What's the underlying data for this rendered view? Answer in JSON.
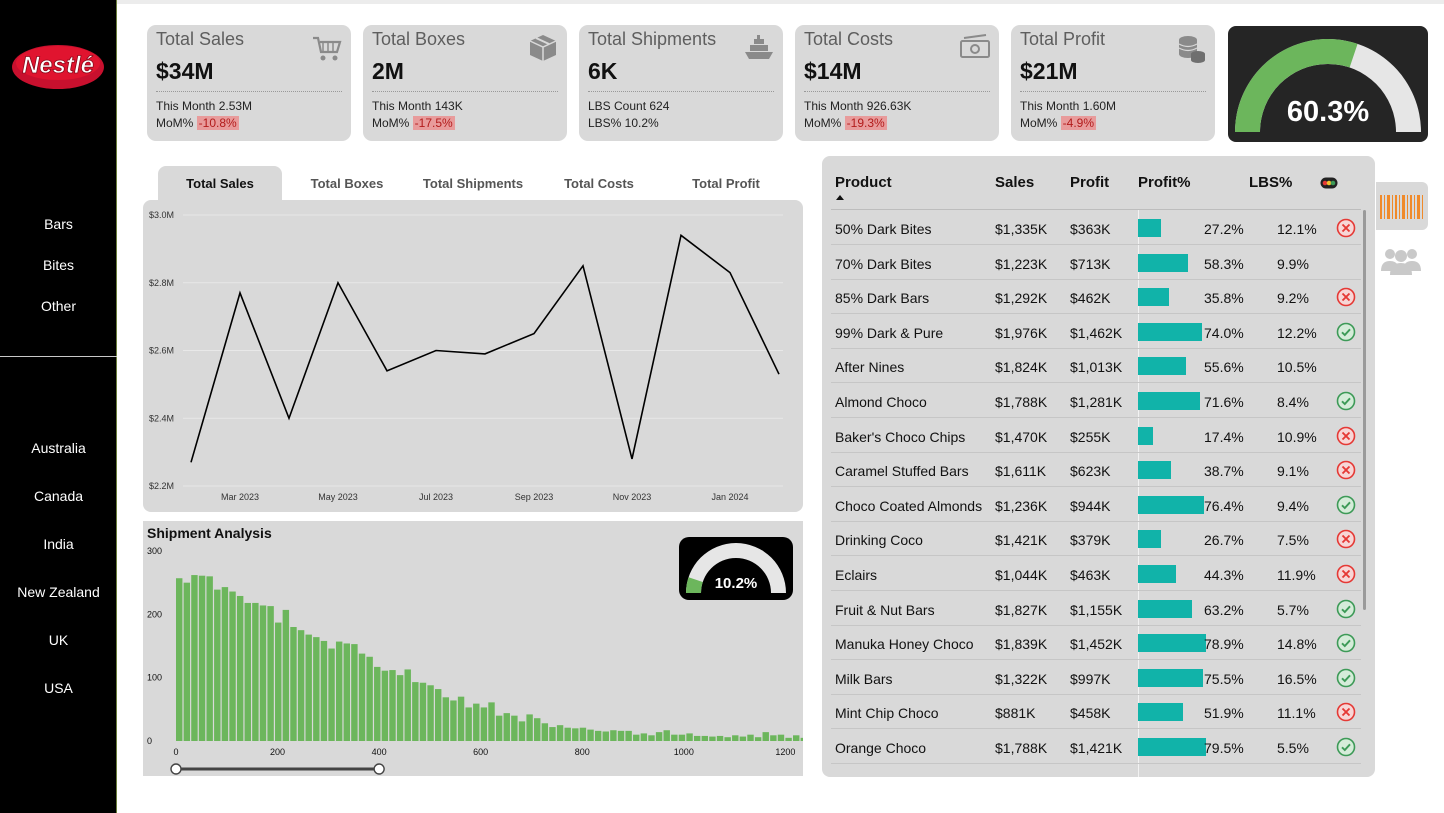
{
  "brand": {
    "logo_text": "Nestlé"
  },
  "sidebar": {
    "categories": [
      "Bars",
      "Bites",
      "Other"
    ],
    "countries": [
      "Australia",
      "Canada",
      "India",
      "New Zealand",
      "UK",
      "USA"
    ]
  },
  "kpis": [
    {
      "title": "Total Sales",
      "value": "$34M",
      "line1": "This Month 2.53M",
      "line2_label": "MoM% ",
      "line2_value": "-10.8%",
      "icon": "shopping-cart-icon"
    },
    {
      "title": "Total Boxes",
      "value": "2M",
      "line1": "This Month 143K",
      "line2_label": "MoM% ",
      "line2_value": "-17.5%",
      "icon": "box-icon"
    },
    {
      "title": "Total Shipments",
      "value": "6K",
      "line1": "LBS Count 624",
      "line2_label": "LBS% 10.2%",
      "line2_value": "",
      "icon": "ship-icon"
    },
    {
      "title": "Total Costs",
      "value": "$14M",
      "line1": "This Month 926.63K",
      "line2_label": "MoM% ",
      "line2_value": "-19.3%",
      "icon": "cash-icon"
    },
    {
      "title": "Total Profit",
      "value": "$21M",
      "line1": "This Month 1.60M",
      "line2_label": "MoM% ",
      "line2_value": "-4.9%",
      "icon": "coins-icon"
    }
  ],
  "profit_gauge": {
    "value_text": "60.3%",
    "fraction": 0.603
  },
  "tabs": [
    "Total Sales",
    "Total Boxes",
    "Total Shipments",
    "Total Costs",
    "Total Profit"
  ],
  "chart_data": [
    {
      "type": "line",
      "title": "",
      "x": [
        "Feb 2023",
        "Mar 2023",
        "Apr 2023",
        "May 2023",
        "Jun 2023",
        "Jul 2023",
        "Aug 2023",
        "Sep 2023",
        "Oct 2023",
        "Nov 2023",
        "Dec 2023",
        "Jan 2024",
        "Feb 2024"
      ],
      "x_tick_labels": [
        "Mar 2023",
        "May 2023",
        "Jul 2023",
        "Sep 2023",
        "Nov 2023",
        "Jan 2024"
      ],
      "y_tick_labels": [
        "$2.2M",
        "$2.4M",
        "$2.6M",
        "$2.8M",
        "$3.0M"
      ],
      "series": [
        {
          "values": [
            2.27,
            2.77,
            2.4,
            2.8,
            2.54,
            2.6,
            2.59,
            2.65,
            2.85,
            2.28,
            2.94,
            2.83,
            2.53
          ]
        }
      ],
      "ylim": [
        2.2,
        3.0
      ],
      "grid": true
    },
    {
      "type": "bar",
      "title": "Shipment Analysis",
      "bin_width": 15,
      "x_start": 0,
      "values": [
        257,
        250,
        262,
        261,
        260,
        239,
        243,
        236,
        229,
        218,
        218,
        214,
        213,
        187,
        207,
        180,
        175,
        168,
        164,
        158,
        146,
        157,
        154,
        153,
        138,
        133,
        117,
        111,
        112,
        104,
        113,
        93,
        92,
        88,
        82,
        69,
        64,
        70,
        53,
        59,
        53,
        61,
        40,
        44,
        40,
        31,
        42,
        36,
        28,
        22,
        25,
        21,
        20,
        21,
        18,
        16,
        15,
        17,
        16,
        16,
        10,
        12,
        9,
        14,
        17,
        10,
        10,
        12,
        8,
        8,
        7,
        8,
        6,
        9,
        7,
        10,
        6,
        14,
        9,
        10,
        5,
        9,
        5,
        7
      ],
      "x_tick_labels": [
        "0",
        "200",
        "400",
        "600",
        "800",
        "1000",
        "1200"
      ],
      "y_tick_labels": [
        "0",
        "100",
        "200",
        "300"
      ],
      "ylim": [
        0,
        300
      ],
      "range_slider": [
        0,
        400
      ]
    }
  ],
  "shipment_gauge": {
    "value_text": "10.2%",
    "fraction": 0.102
  },
  "product_table": {
    "headers": [
      "Product",
      "Sales",
      "Profit",
      "Profit%",
      "LBS%"
    ],
    "rows": [
      {
        "product": "50% Dark Bites",
        "sales": "$1,335K",
        "profit": "$363K",
        "profit_pct": "27.2%",
        "profit_frac": 0.272,
        "lbs": "12.1%",
        "status": "fail"
      },
      {
        "product": "70% Dark Bites",
        "sales": "$1,223K",
        "profit": "$713K",
        "profit_pct": "58.3%",
        "profit_frac": 0.583,
        "lbs": "9.9%",
        "status": "none"
      },
      {
        "product": "85% Dark Bars",
        "sales": "$1,292K",
        "profit": "$462K",
        "profit_pct": "35.8%",
        "profit_frac": 0.358,
        "lbs": "9.2%",
        "status": "fail"
      },
      {
        "product": "99% Dark & Pure",
        "sales": "$1,976K",
        "profit": "$1,462K",
        "profit_pct": "74.0%",
        "profit_frac": 0.74,
        "lbs": "12.2%",
        "status": "ok"
      },
      {
        "product": "After Nines",
        "sales": "$1,824K",
        "profit": "$1,013K",
        "profit_pct": "55.6%",
        "profit_frac": 0.556,
        "lbs": "10.5%",
        "status": "none"
      },
      {
        "product": "Almond Choco",
        "sales": "$1,788K",
        "profit": "$1,281K",
        "profit_pct": "71.6%",
        "profit_frac": 0.716,
        "lbs": "8.4%",
        "status": "ok"
      },
      {
        "product": "Baker's Choco Chips",
        "sales": "$1,470K",
        "profit": "$255K",
        "profit_pct": "17.4%",
        "profit_frac": 0.174,
        "lbs": "10.9%",
        "status": "fail"
      },
      {
        "product": "Caramel Stuffed Bars",
        "sales": "$1,611K",
        "profit": "$623K",
        "profit_pct": "38.7%",
        "profit_frac": 0.387,
        "lbs": "9.1%",
        "status": "fail"
      },
      {
        "product": "Choco Coated Almonds",
        "sales": "$1,236K",
        "profit": "$944K",
        "profit_pct": "76.4%",
        "profit_frac": 0.764,
        "lbs": "9.4%",
        "status": "ok"
      },
      {
        "product": "Drinking Coco",
        "sales": "$1,421K",
        "profit": "$379K",
        "profit_pct": "26.7%",
        "profit_frac": 0.267,
        "lbs": "7.5%",
        "status": "fail"
      },
      {
        "product": "Eclairs",
        "sales": "$1,044K",
        "profit": "$463K",
        "profit_pct": "44.3%",
        "profit_frac": 0.443,
        "lbs": "11.9%",
        "status": "fail"
      },
      {
        "product": "Fruit & Nut Bars",
        "sales": "$1,827K",
        "profit": "$1,155K",
        "profit_pct": "63.2%",
        "profit_frac": 0.632,
        "lbs": "5.7%",
        "status": "ok"
      },
      {
        "product": "Manuka Honey Choco",
        "sales": "$1,839K",
        "profit": "$1,452K",
        "profit_pct": "78.9%",
        "profit_frac": 0.789,
        "lbs": "14.8%",
        "status": "ok"
      },
      {
        "product": "Milk Bars",
        "sales": "$1,322K",
        "profit": "$997K",
        "profit_pct": "75.5%",
        "profit_frac": 0.755,
        "lbs": "16.5%",
        "status": "ok"
      },
      {
        "product": "Mint Chip Choco",
        "sales": "$881K",
        "profit": "$458K",
        "profit_pct": "51.9%",
        "profit_frac": 0.519,
        "lbs": "11.1%",
        "status": "fail"
      },
      {
        "product": "Orange Choco",
        "sales": "$1,788K",
        "profit": "$1,421K",
        "profit_pct": "79.5%",
        "profit_frac": 0.795,
        "lbs": "5.5%",
        "status": "ok"
      }
    ]
  },
  "colors": {
    "sidebar_bg": "#000000",
    "panel_bg": "#d9d9d9",
    "gauge_green": "#6cb65c",
    "bar_teal": "#11b3a9",
    "hist_green": "#6cb65c",
    "negative_bg": "#e89b9b",
    "fail_red": "#e53935",
    "ok_green": "#3d9a57",
    "barcode_orange": "#f08a2a"
  }
}
